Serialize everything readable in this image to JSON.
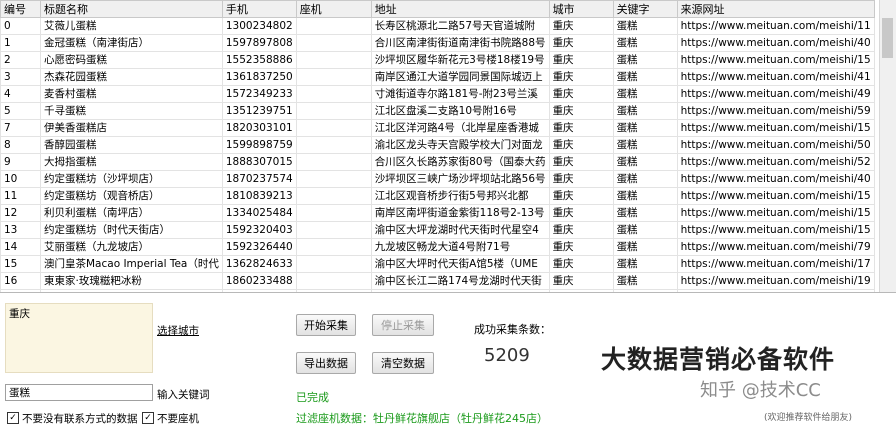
{
  "grid": {
    "columns": [
      "编号",
      "标题名称",
      "手机",
      "座机",
      "地址",
      "城市",
      "关键字",
      "来源网址"
    ],
    "rows": [
      [
        "0",
        "艾薇儿蛋糕",
        "1300234802",
        "",
        "长寿区桃源北二路57号天官道城附",
        "重庆",
        "蛋糕",
        "https://www.meituan.com/meishi/11"
      ],
      [
        "1",
        "金冠蛋糕（南津街店）",
        "1597897808",
        "",
        "合川区南津街街道南津街书院路88号",
        "重庆",
        "蛋糕",
        "https://www.meituan.com/meishi/40"
      ],
      [
        "2",
        "心愿密码蛋糕",
        "1552358886",
        "",
        "沙坪坝区履华新花元3号楼18楼19号",
        "重庆",
        "蛋糕",
        "https://www.meituan.com/meishi/15"
      ],
      [
        "3",
        "杰森花园蛋糕",
        "1361837250",
        "",
        "南岸区通江大道学园同景国际城迈上",
        "重庆",
        "蛋糕",
        "https://www.meituan.com/meishi/41"
      ],
      [
        "4",
        "麦香村蛋糕",
        "1572349233",
        "",
        "寸滩街道寺尔路181号-附23号兰溪",
        "重庆",
        "蛋糕",
        "https://www.meituan.com/meishi/49"
      ],
      [
        "5",
        "千寻蛋糕",
        "1351239751",
        "",
        "江北区盘溪二支路10号附16号",
        "重庆",
        "蛋糕",
        "https://www.meituan.com/meishi/59"
      ],
      [
        "7",
        "伊美香蛋糕店",
        "1820303101",
        "",
        "江北区洋河路4号（北岸星座香港城",
        "重庆",
        "蛋糕",
        "https://www.meituan.com/meishi/15"
      ],
      [
        "8",
        "香醇园蛋糕",
        "1599898759",
        "",
        "渝北区龙头寺天宫殿学校大门对面龙",
        "重庆",
        "蛋糕",
        "https://www.meituan.com/meishi/50"
      ],
      [
        "9",
        "大拇指蛋糕",
        "1888307015",
        "",
        "合川区久长路苏家街80号（国泰大药",
        "重庆",
        "蛋糕",
        "https://www.meituan.com/meishi/52"
      ],
      [
        "10",
        "约定蛋糕坊（沙坪坝店）",
        "1870237574",
        "",
        "沙坪坝区三峡广场沙坪坝站北路56号",
        "重庆",
        "蛋糕",
        "https://www.meituan.com/meishi/40"
      ],
      [
        "11",
        "约定蛋糕坊（观音桥店）",
        "1810839213",
        "",
        "江北区观音桥步行街5号邦兴北都",
        "重庆",
        "蛋糕",
        "https://www.meituan.com/meishi/15"
      ],
      [
        "12",
        "利贝利蛋糕（南坪店）",
        "1334025484",
        "",
        "南岸区南坪街道金紫街118号2-13号",
        "重庆",
        "蛋糕",
        "https://www.meituan.com/meishi/15"
      ],
      [
        "13",
        "约定蛋糕坊（时代天街店）",
        "1592320403",
        "",
        "渝中区大坪龙湖时代天街时代星空4",
        "重庆",
        "蛋糕",
        "https://www.meituan.com/meishi/15"
      ],
      [
        "14",
        "艾丽蛋糕（九龙坡店）",
        "1592326440",
        "",
        "九龙坡区畅龙大道4号附71号",
        "重庆",
        "蛋糕",
        "https://www.meituan.com/meishi/79"
      ],
      [
        "15",
        "澳门皇茶Macao Imperial Tea（时代",
        "1362824633",
        "",
        "渝中区大坪时代天街A馆5楼（UME",
        "重庆",
        "蛋糕",
        "https://www.meituan.com/meishi/17"
      ],
      [
        "16",
        "東東家·玫瑰糍粑冰粉",
        "1860233488",
        "",
        "渝中区长江二路174号龙湖时代天街",
        "重庆",
        "蛋糕",
        "https://www.meituan.com/meishi/19"
      ],
      [
        "17",
        "阿德银花（时代天街D馆店）",
        "1837576521",
        "",
        "渝中区时代天街D馆1-5层（点都都",
        "重庆",
        "蛋糕",
        "https://www.meituan.com/meishi/15"
      ]
    ]
  },
  "panel": {
    "city_value": "重庆",
    "select_city_link": "选择城市",
    "keyword_value": "蛋糕",
    "keyword_label": "输入关键词",
    "filter_no_contact_label": "不要没有联系方式的数据",
    "filter_no_landline_label": "不要座机",
    "check_mark": "✓",
    "start_button": "开始采集",
    "stop_button": "停止采集",
    "export_button": "导出数据",
    "clear_button": "清空数据",
    "success_count_label": "成功采集条数：",
    "success_count": "5209",
    "status_text": "已完成",
    "filter_landline_text": "过滤座机数据：牡丹鲜花旗舰店（牡丹鲜花245店）",
    "brand_text": "大数据营销必备软件",
    "watermark": "知乎 @技术CC",
    "small_note": "(欢迎推荐软件给朋友)"
  }
}
